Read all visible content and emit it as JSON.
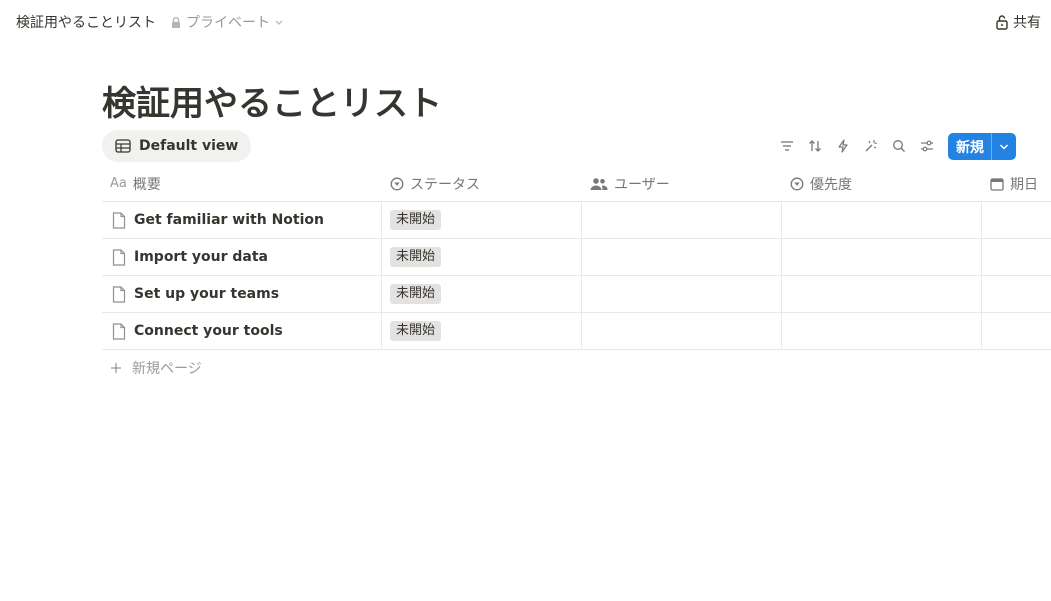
{
  "topbar": {
    "breadcrumb": "検証用やることリスト",
    "privacy": "プライベート",
    "share": "共有"
  },
  "page": {
    "title": "検証用やることリスト"
  },
  "view": {
    "label": "Default view"
  },
  "toolbar": {
    "new_label": "新規"
  },
  "columns": {
    "name": "概要",
    "status": "ステータス",
    "user": "ユーザー",
    "priority": "優先度",
    "date": "期日"
  },
  "rows": [
    {
      "name": "Get familiar with Notion",
      "status": "未開始"
    },
    {
      "name": "Import your data",
      "status": "未開始"
    },
    {
      "name": "Set up your teams",
      "status": "未開始"
    },
    {
      "name": "Connect your tools",
      "status": "未開始"
    }
  ],
  "footer": {
    "new_page": "新規ページ"
  },
  "colors": {
    "accent": "#2383e2",
    "tag_bg": "#e3e2e0",
    "muted": "#9b9a97"
  },
  "icons": [
    "lock-icon",
    "chevron-down-icon",
    "unlock-icon",
    "table-icon",
    "filter-icon",
    "sort-icon",
    "lightning-icon",
    "sparkle-icon",
    "search-icon",
    "sliders-icon",
    "text-icon",
    "status-icon",
    "people-icon",
    "calendar-icon",
    "document-icon",
    "plus-icon"
  ]
}
